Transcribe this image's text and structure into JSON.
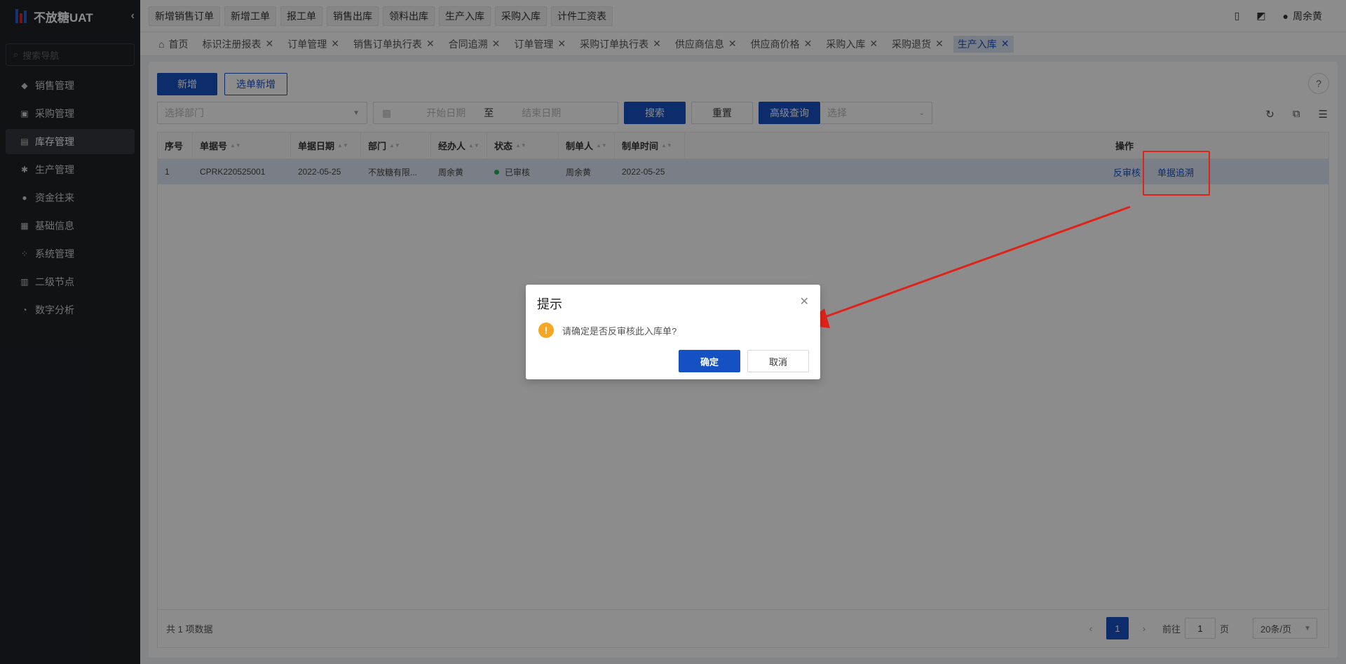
{
  "sidebar": {
    "brand": "不放糖UAT",
    "search_placeholder": "搜索导航",
    "items": [
      {
        "label": "销售管理",
        "icon": "tag-icon"
      },
      {
        "label": "采购管理",
        "icon": "cart-icon"
      },
      {
        "label": "库存管理",
        "icon": "warehouse-icon"
      },
      {
        "label": "生产管理",
        "icon": "production-icon"
      },
      {
        "label": "资金往来",
        "icon": "money-icon"
      },
      {
        "label": "基础信息",
        "icon": "grid-icon"
      },
      {
        "label": "系统管理",
        "icon": "apps-icon"
      },
      {
        "label": "二级节点",
        "icon": "document-icon"
      },
      {
        "label": "数字分析",
        "icon": "pie-icon"
      }
    ],
    "active_index": 2
  },
  "topbar": {
    "quick_links": [
      "新增销售订单",
      "新增工单",
      "报工单",
      "销售出库",
      "领料出库",
      "生产入库",
      "采购入库",
      "计件工资表"
    ],
    "user": "周余黄"
  },
  "tabs": {
    "items": [
      "首页",
      "标识注册报表",
      "订单管理",
      "销售订单执行表",
      "合同追溯",
      "订单管理",
      "采购订单执行表",
      "供应商信息",
      "供应商价格",
      "采购入库",
      "采购退货",
      "生产入库"
    ],
    "active_index": 11
  },
  "toolbar": {
    "add_label": "新增",
    "select_add_label": "选单新增",
    "dept_placeholder": "选择部门",
    "start_date_placeholder": "开始日期",
    "date_sep": "至",
    "end_date_placeholder": "结束日期",
    "search_label": "搜索",
    "reset_label": "重置",
    "advanced_label": "高级查询",
    "advanced_placeholder": "选择"
  },
  "table": {
    "columns": [
      "序号",
      "单据号",
      "单据日期",
      "部门",
      "经办人",
      "状态",
      "制单人",
      "制单时间",
      "操作"
    ],
    "rows": [
      {
        "index": "1",
        "doc_no": "CPRK220525001",
        "doc_date": "2022-05-25",
        "dept": "不放糖有限...",
        "handler": "周余黄",
        "status": "已审核",
        "creator": "周余黄",
        "created": "2022-05-25",
        "action1": "反审核",
        "action2": "单据追溯"
      }
    ],
    "status_color": "#22b14c"
  },
  "footer": {
    "total": "共 1 项数据",
    "current_page": "1",
    "goto_label": "前往",
    "goto_value": "1",
    "page_unit": "页",
    "page_size": "20条/页"
  },
  "dialog": {
    "title": "提示",
    "message": "请确定是否反审核此入库单?",
    "ok_label": "确定",
    "cancel_label": "取消"
  },
  "colors": {
    "primary": "#1651c4",
    "annotation": "#e0231a"
  }
}
